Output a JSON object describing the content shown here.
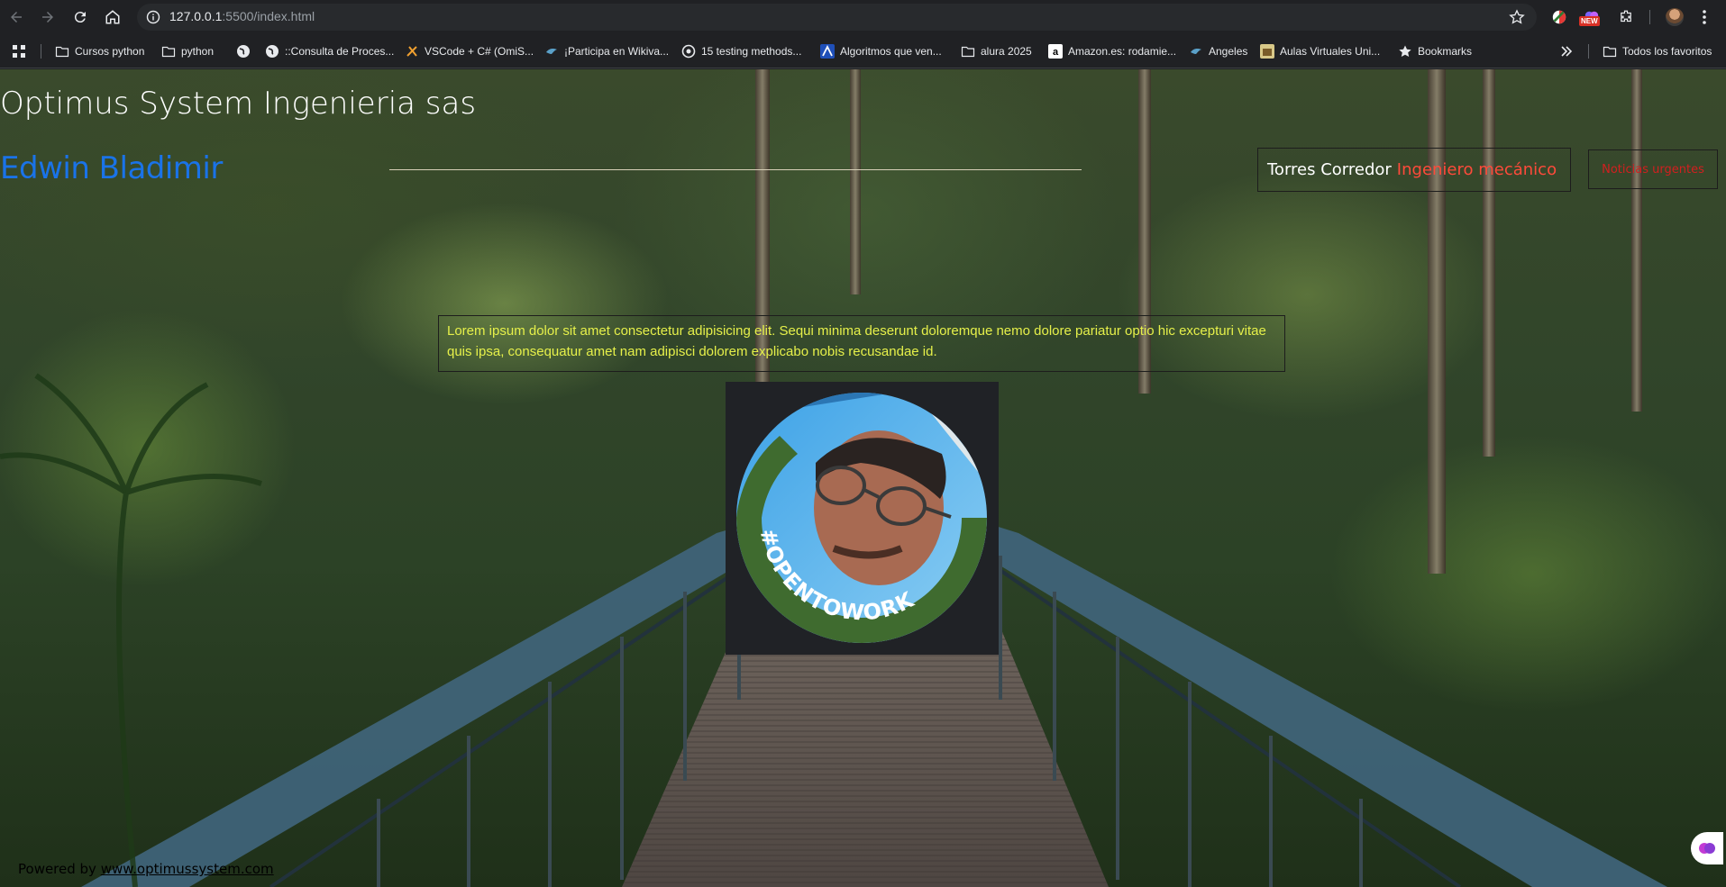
{
  "browser": {
    "url_host": "127.0.0.1",
    "url_path": ":5500/index.html",
    "new_badge": "NEW"
  },
  "bookmarks": [
    {
      "label": "Cursos python",
      "icon": "folder-icon"
    },
    {
      "label": "python",
      "icon": "folder-icon"
    },
    {
      "label": "",
      "icon": "globe-icon"
    },
    {
      "label": "::Consulta de Proces...",
      "icon": "globe-icon"
    },
    {
      "label": "VSCode + C# (OmiS...",
      "icon": "site-icon"
    },
    {
      "label": "¡Participa en Wikiva...",
      "icon": "bird-icon"
    },
    {
      "label": "15 testing methods...",
      "icon": "site-icon"
    },
    {
      "label": "Algoritmos que ven...",
      "icon": "site-icon"
    },
    {
      "label": "alura 2025",
      "icon": "folder-icon"
    },
    {
      "label": "Amazon.es: rodamie...",
      "icon": "amazon-icon"
    },
    {
      "label": "Angeles",
      "icon": "bird-icon"
    },
    {
      "label": "Aulas Virtuales Uni...",
      "icon": "site-icon"
    },
    {
      "label": "Bookmarks",
      "icon": "star-icon"
    },
    {
      "label": "Todos los favoritos",
      "icon": "folder-icon"
    }
  ],
  "page": {
    "title": "Optimus System Ingenieria sas",
    "first_name": "Edwin Bladimir",
    "last_name": "Torres Corredor",
    "role": "Ingeniero mecánico",
    "news_button": "Noticias urgentes",
    "description": "Lorem ipsum dolor sit amet consectetur adipisicing elit. Sequi minima deserunt doloremque nemo dolore pariatur optio hic excepturi vitae quis ipsa, consequatur amet nam adipisci dolorem explicabo nobis recusandae id.",
    "photo_badge": "#OPENTOWORK",
    "footer_prefix": "Powered by",
    "footer_link": "www.optimussystem.com"
  },
  "colors": {
    "first_name": "#1a73e8",
    "role": "#ff4a3a",
    "news": "#d21f1f",
    "description": "#e6f04a",
    "opentowork_ring": "#3f6b2f"
  }
}
